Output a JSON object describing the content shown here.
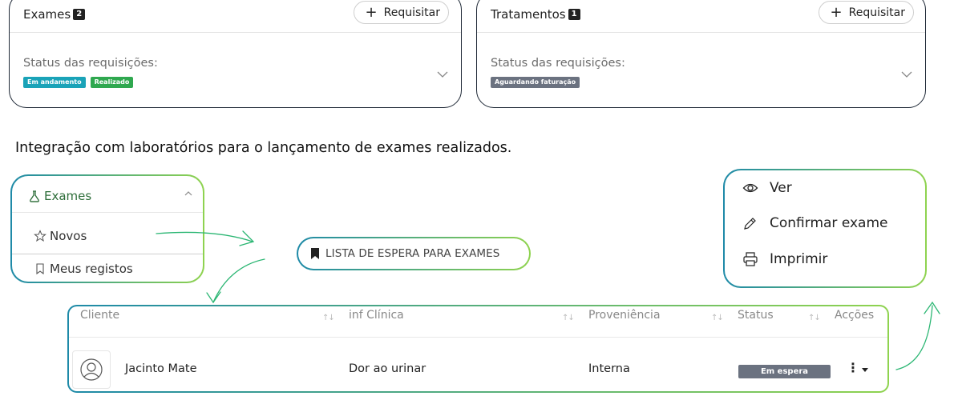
{
  "cards": [
    {
      "title": "Exames",
      "count": "2",
      "request_label": "Requisitar",
      "status_label": "Status das requisições:",
      "tags": [
        {
          "label": "Em andamento",
          "color": "#1aa3b8"
        },
        {
          "label": "Realizado",
          "color": "#2fa84f"
        }
      ]
    },
    {
      "title": "Tratamentos",
      "count": "1",
      "request_label": "Requisitar",
      "status_label": "Status das requisições:",
      "tags": [
        {
          "label": "Aguardando faturação",
          "color": "#6b7280"
        }
      ]
    }
  ],
  "description": "Integração com laboratórios para o lançamento de exames realizados.",
  "menu": {
    "section": "Exames",
    "items": [
      "Novos",
      "Meus registos"
    ]
  },
  "waiting_list_title": "LISTA DE ESPERA PARA EXAMES",
  "actions": [
    "Ver",
    "Confirmar exame",
    "Imprimir"
  ],
  "table": {
    "columns": [
      "Cliente",
      "inf Clínica",
      "Proveniência",
      "Status",
      "Acções"
    ],
    "sort_glyph": "↑↓",
    "rows": [
      {
        "cliente": "Jacinto Mate",
        "info": "Dor ao urinar",
        "proveniencia": "Interna",
        "status": "Em espera",
        "kebab": "⋮"
      }
    ]
  },
  "colors": {
    "outline_start": "#1e8aa8",
    "outline_end": "#8fd34f",
    "arrow": "#2bb673",
    "menu_active": "#2e6e3a",
    "status_badge": "#6b7280"
  }
}
